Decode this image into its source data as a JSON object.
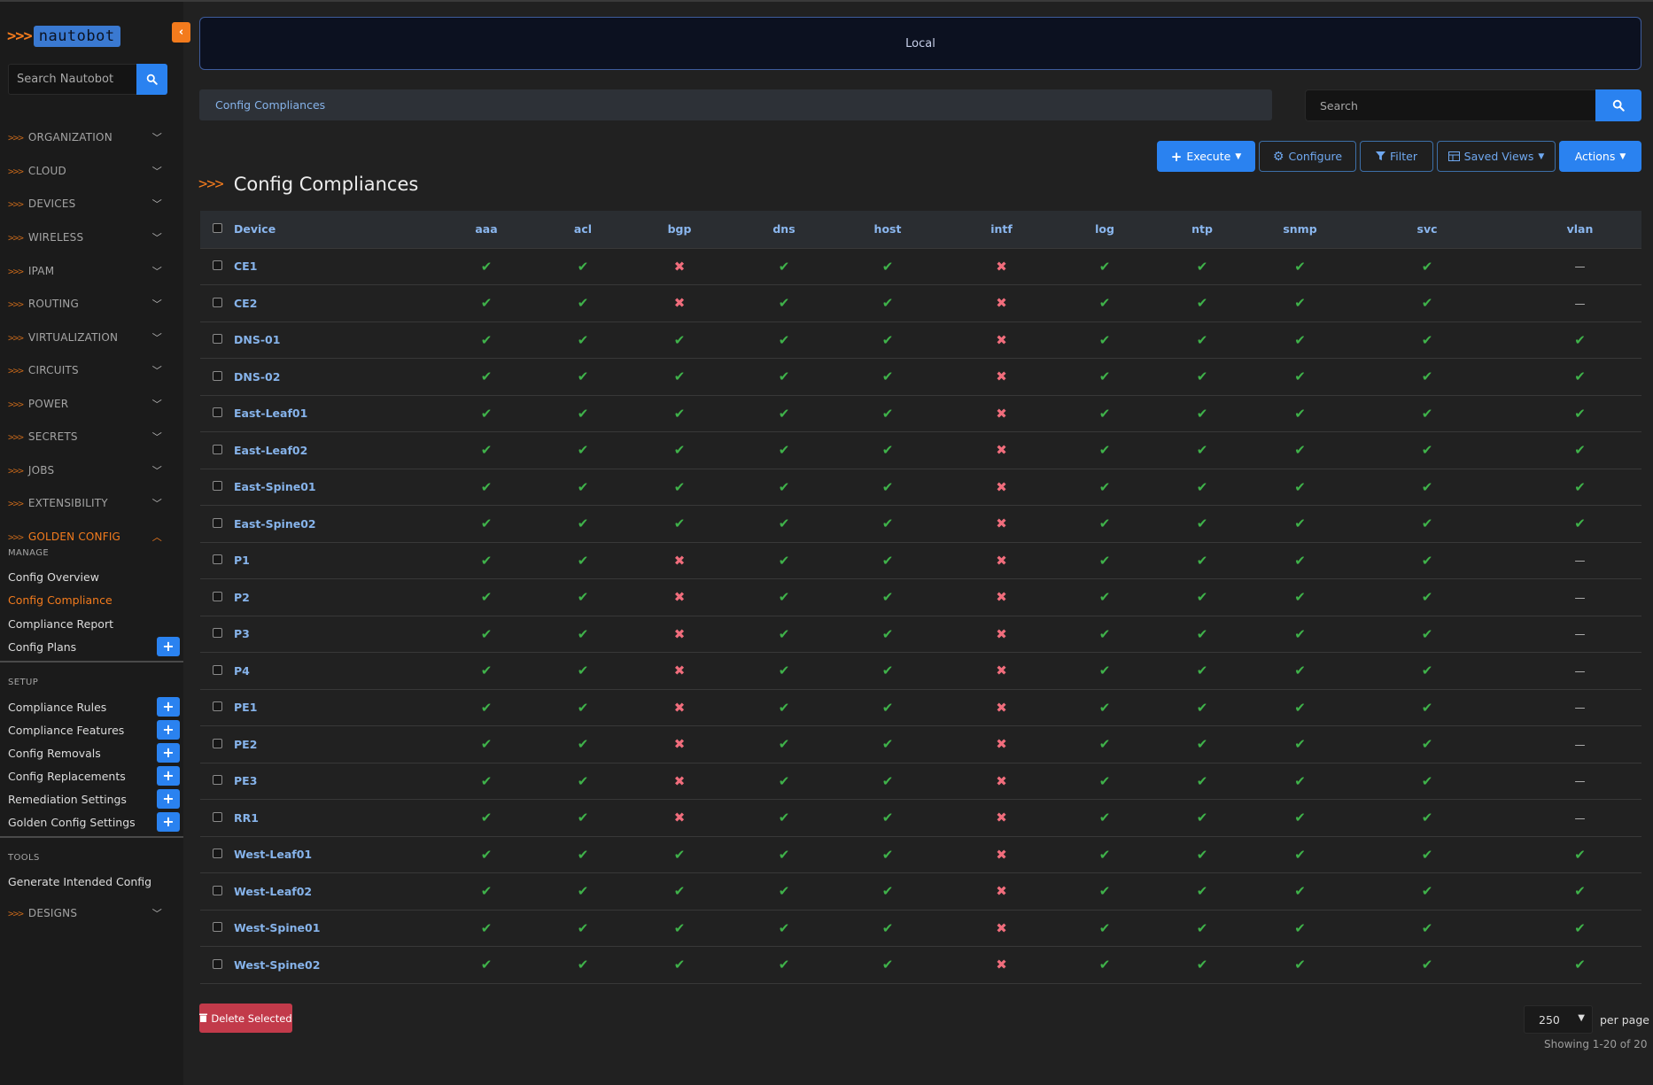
{
  "logo": {
    "arrows": ">>>",
    "text": "nautobot"
  },
  "sidebar": {
    "search_placeholder": "Search Nautobot",
    "groups": [
      {
        "label": "ORGANIZATION"
      },
      {
        "label": "CLOUD"
      },
      {
        "label": "DEVICES"
      },
      {
        "label": "WIRELESS"
      },
      {
        "label": "IPAM"
      },
      {
        "label": "ROUTING"
      },
      {
        "label": "VIRTUALIZATION"
      },
      {
        "label": "CIRCUITS"
      },
      {
        "label": "POWER"
      },
      {
        "label": "SECRETS"
      },
      {
        "label": "JOBS"
      },
      {
        "label": "EXTENSIBILITY"
      },
      {
        "label": "GOLDEN CONFIG"
      }
    ],
    "manage": {
      "heading": "MANAGE",
      "items": [
        "Config Overview",
        "Config Compliance",
        "Compliance Report",
        "Config Plans"
      ]
    },
    "setup": {
      "heading": "SETUP",
      "items": [
        "Compliance Rules",
        "Compliance Features",
        "Config Removals",
        "Config Replacements",
        "Remediation Settings",
        "Golden Config Settings"
      ]
    },
    "tools": {
      "heading": "TOOLS",
      "items": [
        "Generate Intended Config"
      ]
    },
    "designs": {
      "label": "DESIGNS"
    }
  },
  "banner": {
    "text": "Local"
  },
  "breadcrumb": {
    "text": "Config Compliances"
  },
  "search": {
    "placeholder": "Search"
  },
  "toolbar": {
    "execute": "Execute",
    "configure": "Configure",
    "filter": "Filter",
    "saved_views": "Saved Views",
    "actions": "Actions"
  },
  "page_title": "Config Compliances",
  "table": {
    "columns": [
      "Device",
      "aaa",
      "acl",
      "bgp",
      "dns",
      "host",
      "intf",
      "log",
      "ntp",
      "snmp",
      "svc",
      "vlan"
    ],
    "rows": [
      {
        "device": "CE1",
        "status": [
          "ok",
          "ok",
          "bad",
          "ok",
          "ok",
          "bad",
          "ok",
          "ok",
          "ok",
          "ok",
          "na"
        ]
      },
      {
        "device": "CE2",
        "status": [
          "ok",
          "ok",
          "bad",
          "ok",
          "ok",
          "bad",
          "ok",
          "ok",
          "ok",
          "ok",
          "na"
        ]
      },
      {
        "device": "DNS-01",
        "status": [
          "ok",
          "ok",
          "ok",
          "ok",
          "ok",
          "bad",
          "ok",
          "ok",
          "ok",
          "ok",
          "ok"
        ]
      },
      {
        "device": "DNS-02",
        "status": [
          "ok",
          "ok",
          "ok",
          "ok",
          "ok",
          "bad",
          "ok",
          "ok",
          "ok",
          "ok",
          "ok"
        ]
      },
      {
        "device": "East-Leaf01",
        "status": [
          "ok",
          "ok",
          "ok",
          "ok",
          "ok",
          "bad",
          "ok",
          "ok",
          "ok",
          "ok",
          "ok"
        ]
      },
      {
        "device": "East-Leaf02",
        "status": [
          "ok",
          "ok",
          "ok",
          "ok",
          "ok",
          "bad",
          "ok",
          "ok",
          "ok",
          "ok",
          "ok"
        ]
      },
      {
        "device": "East-Spine01",
        "status": [
          "ok",
          "ok",
          "ok",
          "ok",
          "ok",
          "bad",
          "ok",
          "ok",
          "ok",
          "ok",
          "ok"
        ]
      },
      {
        "device": "East-Spine02",
        "status": [
          "ok",
          "ok",
          "ok",
          "ok",
          "ok",
          "bad",
          "ok",
          "ok",
          "ok",
          "ok",
          "ok"
        ]
      },
      {
        "device": "P1",
        "status": [
          "ok",
          "ok",
          "bad",
          "ok",
          "ok",
          "bad",
          "ok",
          "ok",
          "ok",
          "ok",
          "na"
        ]
      },
      {
        "device": "P2",
        "status": [
          "ok",
          "ok",
          "bad",
          "ok",
          "ok",
          "bad",
          "ok",
          "ok",
          "ok",
          "ok",
          "na"
        ]
      },
      {
        "device": "P3",
        "status": [
          "ok",
          "ok",
          "bad",
          "ok",
          "ok",
          "bad",
          "ok",
          "ok",
          "ok",
          "ok",
          "na"
        ]
      },
      {
        "device": "P4",
        "status": [
          "ok",
          "ok",
          "bad",
          "ok",
          "ok",
          "bad",
          "ok",
          "ok",
          "ok",
          "ok",
          "na"
        ]
      },
      {
        "device": "PE1",
        "status": [
          "ok",
          "ok",
          "bad",
          "ok",
          "ok",
          "bad",
          "ok",
          "ok",
          "ok",
          "ok",
          "na"
        ]
      },
      {
        "device": "PE2",
        "status": [
          "ok",
          "ok",
          "bad",
          "ok",
          "ok",
          "bad",
          "ok",
          "ok",
          "ok",
          "ok",
          "na"
        ]
      },
      {
        "device": "PE3",
        "status": [
          "ok",
          "ok",
          "bad",
          "ok",
          "ok",
          "bad",
          "ok",
          "ok",
          "ok",
          "ok",
          "na"
        ]
      },
      {
        "device": "RR1",
        "status": [
          "ok",
          "ok",
          "bad",
          "ok",
          "ok",
          "bad",
          "ok",
          "ok",
          "ok",
          "ok",
          "na"
        ]
      },
      {
        "device": "West-Leaf01",
        "status": [
          "ok",
          "ok",
          "ok",
          "ok",
          "ok",
          "bad",
          "ok",
          "ok",
          "ok",
          "ok",
          "ok"
        ]
      },
      {
        "device": "West-Leaf02",
        "status": [
          "ok",
          "ok",
          "ok",
          "ok",
          "ok",
          "bad",
          "ok",
          "ok",
          "ok",
          "ok",
          "ok"
        ]
      },
      {
        "device": "West-Spine01",
        "status": [
          "ok",
          "ok",
          "ok",
          "ok",
          "ok",
          "bad",
          "ok",
          "ok",
          "ok",
          "ok",
          "ok"
        ]
      },
      {
        "device": "West-Spine02",
        "status": [
          "ok",
          "ok",
          "ok",
          "ok",
          "ok",
          "bad",
          "ok",
          "ok",
          "ok",
          "ok",
          "ok"
        ]
      }
    ]
  },
  "status_glyphs": {
    "ok": "✔",
    "bad": "✖",
    "na": "—"
  },
  "status_icons": {
    "ok": "check-icon",
    "bad": "cross-icon",
    "na": "dash-icon"
  },
  "footer": {
    "delete_label": "Delete Selected",
    "per_page_value": "250",
    "per_page_label": "per page",
    "showing": "Showing 1-20 of 20"
  },
  "colors": {
    "accent_orange": "#f37b1d",
    "primary_blue": "#2a82f0",
    "link_blue": "#86b3ea",
    "ok_green": "#3fb24a",
    "bad_red": "#f06d7c",
    "danger": "#c23a4a"
  }
}
